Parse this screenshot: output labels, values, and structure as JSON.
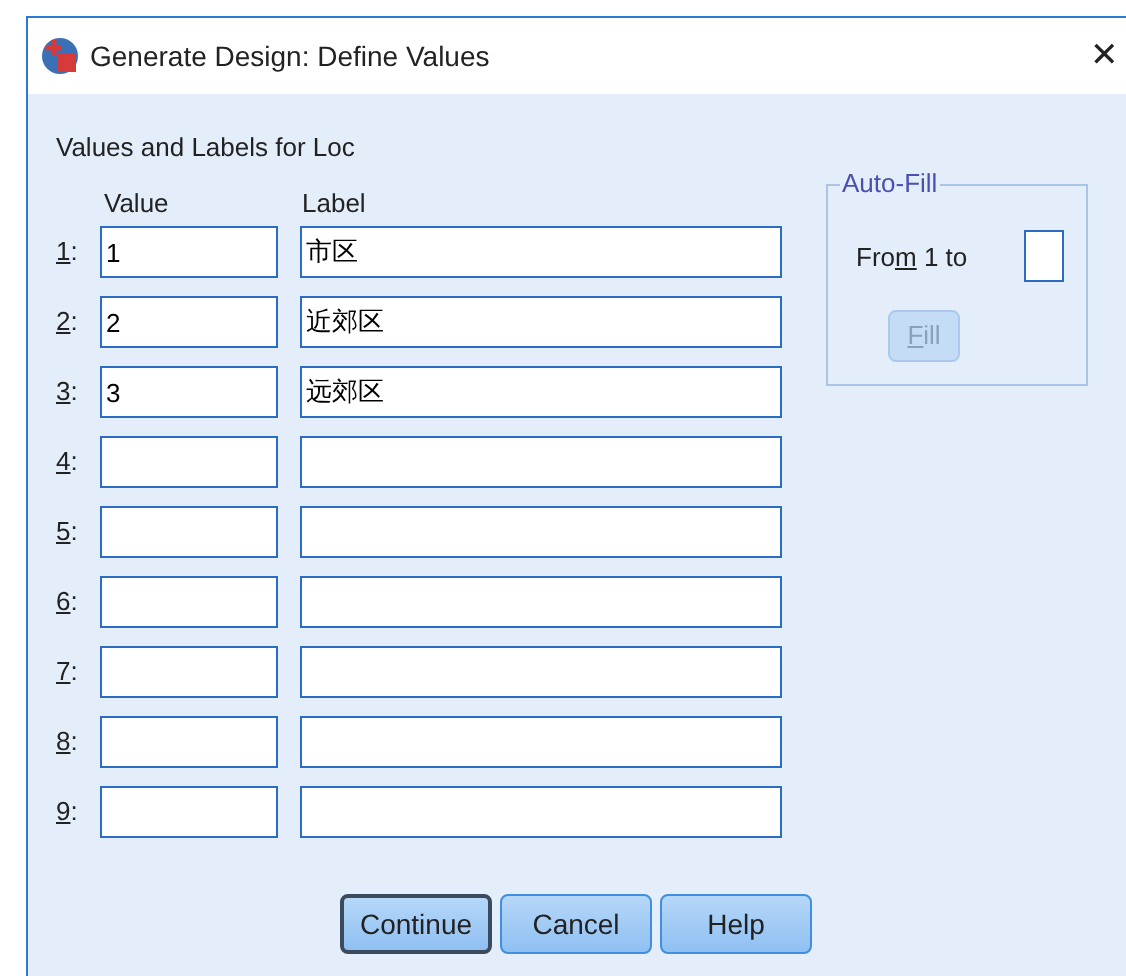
{
  "window": {
    "title": "Generate Design: Define Values",
    "close": "✕"
  },
  "heading": "Values and Labels for Loc",
  "columns": [
    "Value",
    "Label"
  ],
  "rows": [
    {
      "number": "1:",
      "underline_first": true,
      "value": "1",
      "label": "市区"
    },
    {
      "number": "2:",
      "underline_first": true,
      "value": "2",
      "label": "近郊区"
    },
    {
      "number": "3:",
      "underline_first": true,
      "value": "3",
      "label": "远郊区"
    },
    {
      "number": "4:",
      "underline_first": true,
      "value": "",
      "label": ""
    },
    {
      "number": "5:",
      "underline_first": true,
      "value": "",
      "label": ""
    },
    {
      "number": "6:",
      "underline_first": true,
      "value": "",
      "label": ""
    },
    {
      "number": "7:",
      "underline_first": true,
      "value": "",
      "label": ""
    },
    {
      "number": "8:",
      "underline_first": true,
      "value": "",
      "label": ""
    },
    {
      "number": "9:",
      "underline_first": true,
      "value": "",
      "label": ""
    }
  ],
  "auto_fill": {
    "title": "Auto-Fill",
    "from_label": [
      {
        "text": "Fro",
        "underlined": false
      },
      {
        "text": "m",
        "underlined": true
      },
      {
        "text": " 1 to",
        "underlined": false
      }
    ],
    "button": {
      "label": "Fill",
      "underline_first": true,
      "disabled": true
    }
  },
  "buttons": [
    {
      "label": "Continue",
      "default": true
    },
    {
      "label": "Cancel",
      "default": false
    },
    {
      "label": "Help",
      "default": false
    }
  ]
}
